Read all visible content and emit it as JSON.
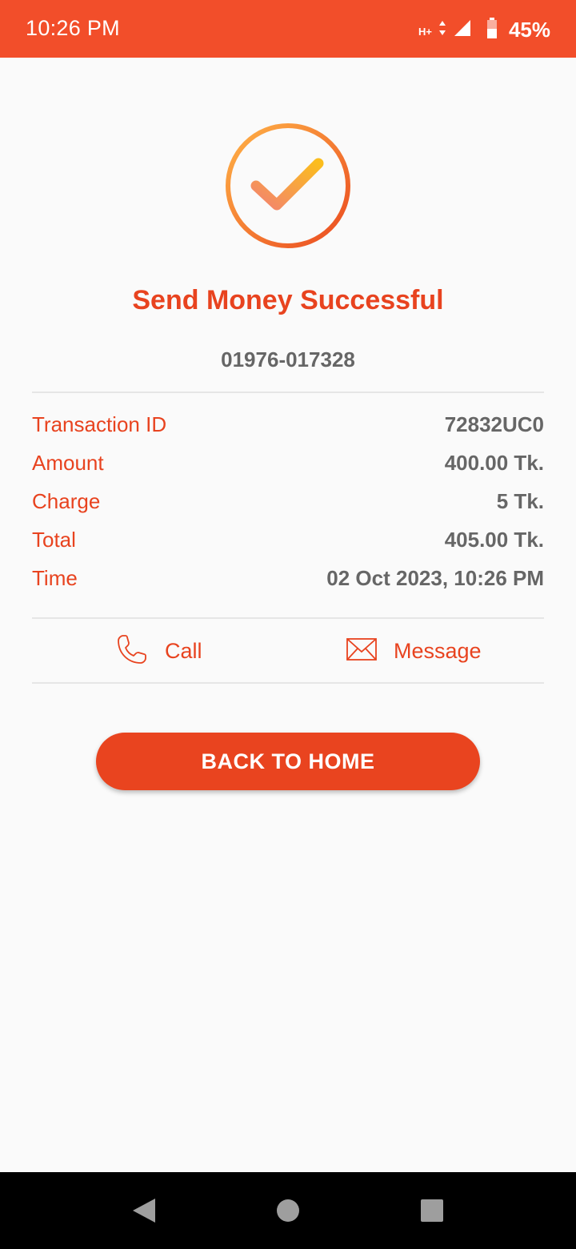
{
  "status_bar": {
    "time": "10:26 PM",
    "network": "H+",
    "battery": "45%",
    "icons": [
      "network-type-icon",
      "signal-icon",
      "battery-icon"
    ]
  },
  "colors": {
    "accent": "#e8431f",
    "status_bar": "#f24e2a",
    "value_text": "#666666",
    "background": "#fafafa"
  },
  "success": {
    "icon": "checkmark-circle-icon",
    "title": "Send Money Successful",
    "recipient_number": "01976-017328"
  },
  "details": [
    {
      "label": "Transaction ID",
      "value": "72832UC0"
    },
    {
      "label": "Amount",
      "value": "400.00 Tk."
    },
    {
      "label": "Charge",
      "value": "5 Tk."
    },
    {
      "label": "Total",
      "value": "405.00 Tk."
    },
    {
      "label": "Time",
      "value": "02 Oct 2023, 10:26 PM"
    }
  ],
  "actions": {
    "call": {
      "label": "Call",
      "icon": "phone-icon"
    },
    "message": {
      "label": "Message",
      "icon": "envelope-icon"
    }
  },
  "home_button": {
    "label": "BACK TO HOME"
  },
  "nav_bar": {
    "icons": [
      "back-icon",
      "home-icon",
      "recents-icon"
    ]
  }
}
